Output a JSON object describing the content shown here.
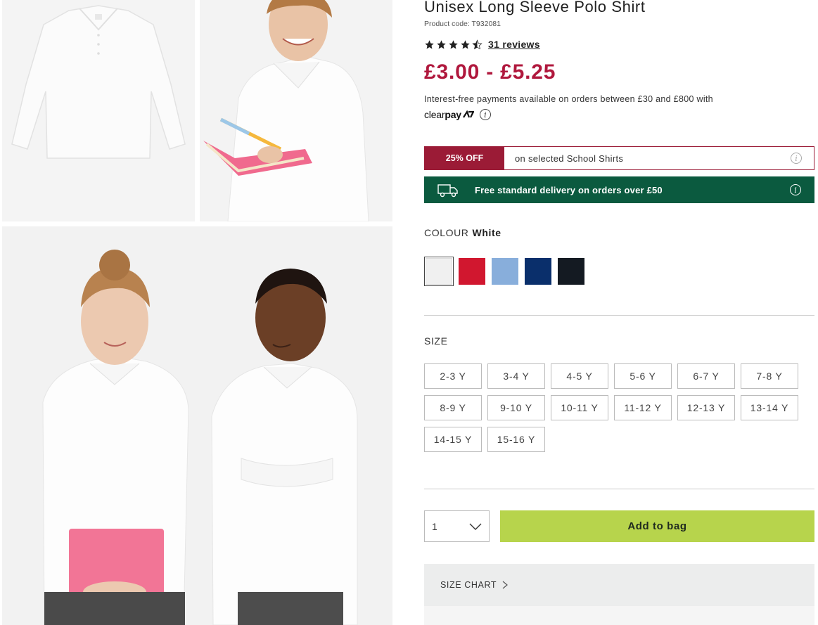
{
  "product": {
    "title": "Unisex Long Sleeve Polo Shirt",
    "code": "Product code: T932081",
    "rating": 4.5,
    "reviews": "31 reviews",
    "price": "£3.00 - £5.25"
  },
  "payments": {
    "text": "Interest-free payments available on orders between £30 and £800 with",
    "provider_part1": "clear",
    "provider_part2": "pay"
  },
  "offer": {
    "badge": "25% OFF",
    "text": "on selected School Shirts"
  },
  "delivery": {
    "text": "Free standard delivery on orders over £50"
  },
  "colour": {
    "label": "COLOUR",
    "selected": "White",
    "swatches": [
      {
        "name": "White",
        "hex": "#f0f0f0"
      },
      {
        "name": "Red",
        "hex": "#d1172f"
      },
      {
        "name": "Light Blue",
        "hex": "#88aedb"
      },
      {
        "name": "Navy",
        "hex": "#0a2f6b"
      },
      {
        "name": "Black",
        "hex": "#141a22"
      }
    ]
  },
  "size": {
    "label": "SIZE",
    "options": [
      "2-3 Y",
      "3-4 Y",
      "4-5 Y",
      "5-6 Y",
      "6-7 Y",
      "7-8 Y",
      "8-9 Y",
      "9-10 Y",
      "10-11 Y",
      "11-12 Y",
      "12-13 Y",
      "13-14 Y",
      "14-15 Y",
      "15-16 Y"
    ]
  },
  "quantity": {
    "value": "1"
  },
  "actions": {
    "add_to_bag": "Add to bag",
    "size_chart": "SIZE CHART"
  },
  "colors": {
    "price": "#b0183d",
    "offer": "#9b1b36",
    "delivery": "#0b5a3f",
    "add_button": "#b7d44c"
  }
}
